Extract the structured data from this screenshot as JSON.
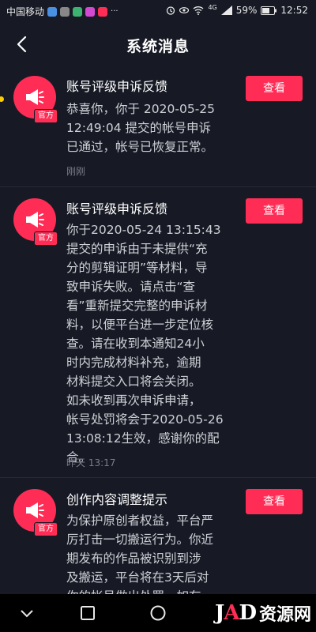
{
  "status_bar": {
    "carrier": "中国移动",
    "battery": "59%",
    "time": "12:52",
    "signal_label": "4G"
  },
  "header": {
    "title": "系统消息"
  },
  "messages": [
    {
      "title": "账号评级申诉反馈",
      "badge": "官方",
      "body": "恭喜你，你于 2020-05-25\n12:49:04 提交的帐号申诉\n已通过，帐号已恢复正常。",
      "time": "刚刚",
      "button": "查看"
    },
    {
      "title": "账号评级申诉反馈",
      "badge": "官方",
      "body": "你于2020-05-24 13:15:43\n提交的申诉由于未提供“充\n分的剪辑证明”等材料，导\n致申诉失败。请点击“查\n看”重新提交完整的申诉材\n料，以便平台进一步定位核\n查。请在收到本通知24小\n时内完成材料补充，逾期\n材料提交入口将会关闭。\n如未收到再次申诉申请，\n帐号处罚将会于2020-05-26\n13:08:12生效，感谢你的配\n合。",
      "time": "昨天 13:17",
      "button": "查看"
    },
    {
      "title": "创作内容调整提示",
      "badge": "官方",
      "body": "为保护原创者权益，平台严\n厉打击一切搬运行为。你近\n期发布的作品被识别到涉\n及搬运，平台将在3天后对\n你的帐号做出处罚。如有",
      "button": "查看"
    }
  ],
  "watermark": {
    "logo_j": "J",
    "logo_a": "A",
    "logo_d": "D",
    "text": "资源网"
  }
}
